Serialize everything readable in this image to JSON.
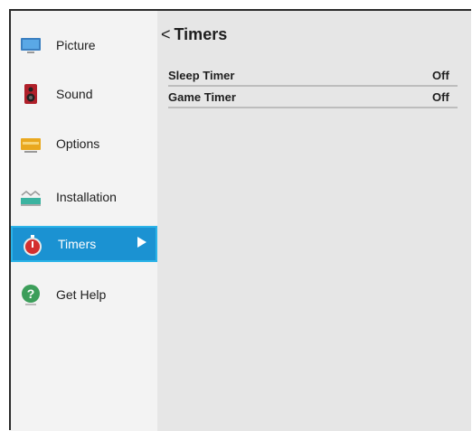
{
  "sidebar": {
    "items": [
      {
        "label": "Picture",
        "icon": "picture-icon"
      },
      {
        "label": "Sound",
        "icon": "speaker-icon"
      },
      {
        "label": "Options",
        "icon": "options-icon"
      },
      {
        "label": "Installation",
        "icon": "installation-icon"
      },
      {
        "label": "Timers",
        "icon": "stopwatch-icon",
        "selected": true
      },
      {
        "label": "Get Help",
        "icon": "help-icon"
      }
    ]
  },
  "main": {
    "back_symbol": "<",
    "title": "Timers",
    "rows": [
      {
        "label": "Sleep Timer",
        "value": "Off"
      },
      {
        "label": "Game Timer",
        "value": "Off"
      }
    ]
  },
  "colors": {
    "accent": "#1b92d2",
    "accent_border": "#2bb3e8",
    "sidebar_bg": "#f3f3f3",
    "main_bg": "#e6e6e6"
  }
}
